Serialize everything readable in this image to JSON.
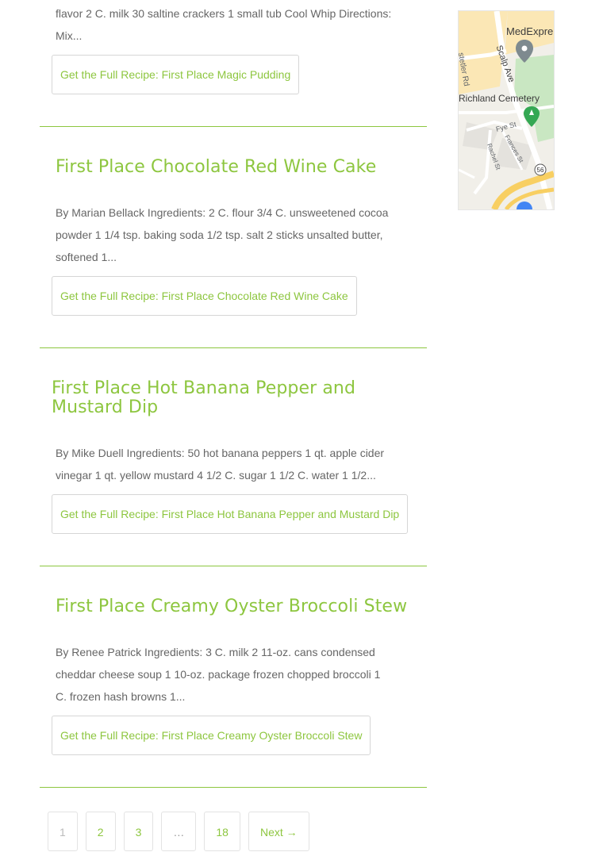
{
  "posts": [
    {
      "excerpt_lines": [
        "flavor 2 C. milk 30 saltine crackers 1 small tub Cool Whip Directions:",
        "Mix..."
      ],
      "link": "Get the Full Recipe: First Place Magic Pudding"
    },
    {
      "title": "First Place Chocolate Red Wine Cake",
      "excerpt_lines": [
        "By Marian Bellack Ingredients: 2 C. flour 3/4 C. unsweetened cocoa",
        "powder 1 1/4 tsp. baking soda 1/2 tsp. salt 2 sticks unsalted butter,",
        "softened 1..."
      ],
      "link": "Get the Full Recipe: First Place Chocolate Red Wine Cake"
    },
    {
      "title": "First Place Hot Banana Pepper and Mustard Dip",
      "excerpt_lines": [
        "By Mike Duell Ingredients: 50 hot banana peppers 1 qt. apple cider",
        "vinegar 1 qt. yellow mustard 4 1/2 C. sugar 1 1/2 C. water 1 1/2..."
      ],
      "link": "Get the Full Recipe: First Place Hot Banana Pepper and Mustard Dip"
    },
    {
      "title": "First Place Creamy Oyster Broccoli Stew",
      "excerpt_lines": [
        "By Renee Patrick Ingredients: 3 C. milk 2 11-oz. cans condensed",
        "cheddar cheese soup 1 10-oz. package frozen chopped broccoli 1",
        "C. frozen hash browns 1..."
      ],
      "link": "Get the Full Recipe: First Place Creamy Oyster Broccoli Stew"
    }
  ],
  "pagination": {
    "pages": [
      "1",
      "2",
      "3",
      "…",
      "18"
    ],
    "next": "Next →",
    "current": "1"
  },
  "map": {
    "labels": {
      "medexpress": "MedExpre",
      "scalp_ave": "Scalp Ave",
      "stetler_rd": "stetler Rd",
      "cemetery": "Richland Cemetery",
      "fye_st": "Fye St",
      "frances_st": "Frances St",
      "rachel_st": "Rachel St",
      "route": "56"
    },
    "colors": {
      "land": "#f1efe9",
      "business": "#fbe7b5",
      "park": "#c9e7c2",
      "road": "#ffffff",
      "highway": "#f8cf62",
      "marker_gray": "#7e8a8f",
      "marker_green": "#34a853",
      "marker_blue": "#4285f4"
    }
  },
  "theme": {
    "accent": "#8dc63f",
    "text": "#666666",
    "border": "#d6d6d6"
  }
}
